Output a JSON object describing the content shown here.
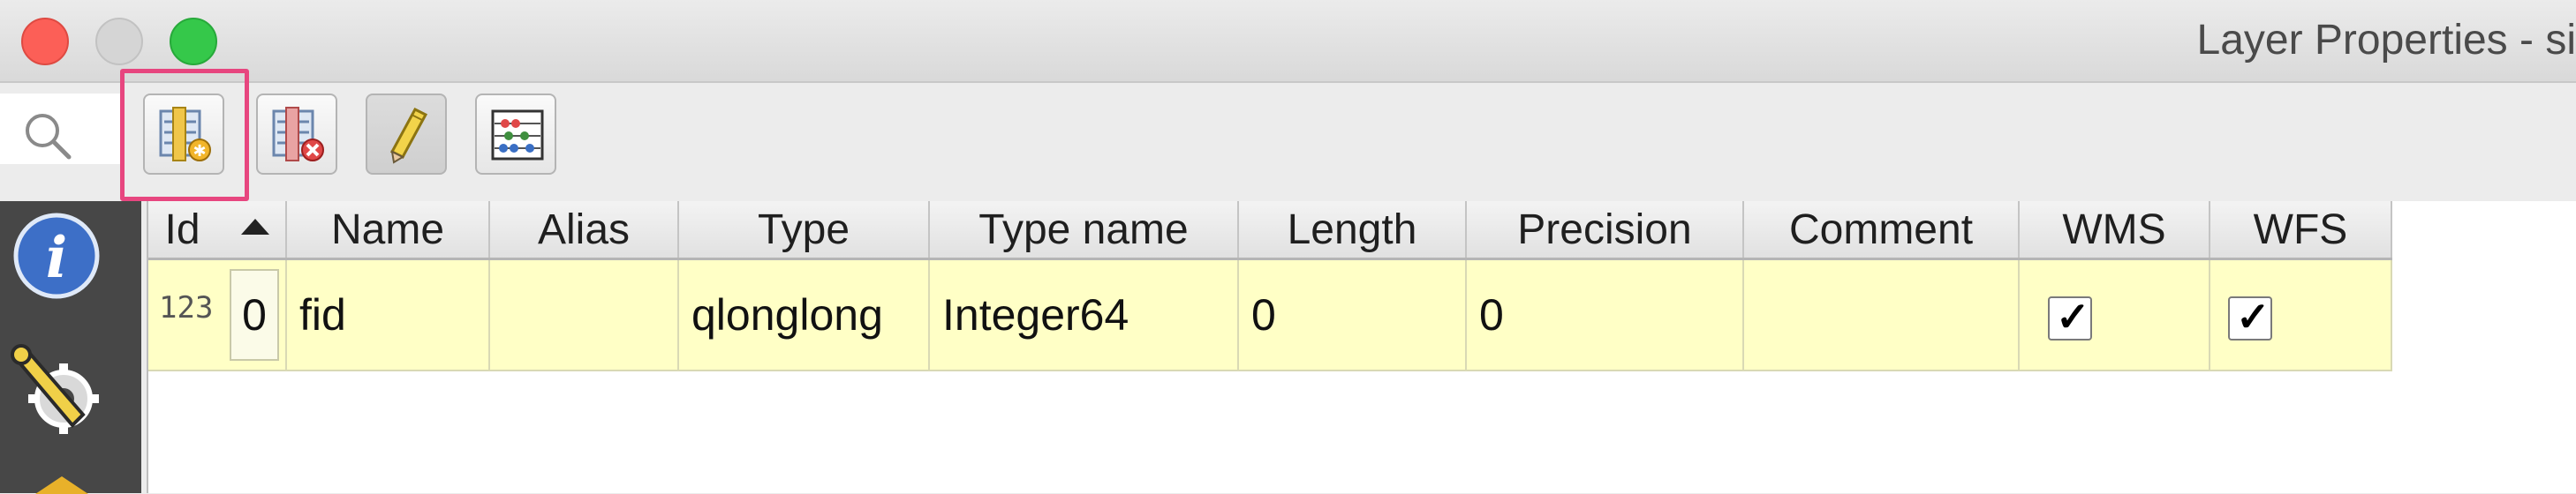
{
  "window": {
    "title": "Layer Properties - si"
  },
  "toolbar": {
    "buttons": [
      {
        "name": "new-field-button",
        "icon": "new-field-icon",
        "tooltip": ""
      },
      {
        "name": "delete-field-button",
        "icon": "delete-field-icon",
        "tooltip": ""
      },
      {
        "name": "toggle-editing-button",
        "icon": "pencil-icon",
        "tooltip": ""
      },
      {
        "name": "field-calculator-button",
        "icon": "abacus-icon",
        "tooltip": ""
      }
    ],
    "highlight_color": "#e7467f"
  },
  "sidebar": {
    "icons": [
      "information-icon",
      "source-settings-icon",
      "symbology-icon"
    ]
  },
  "table": {
    "headers": {
      "id": "Id",
      "name": "Name",
      "alias": "Alias",
      "type": "Type",
      "type_name": "Type name",
      "length": "Length",
      "precision": "Precision",
      "comment": "Comment",
      "wms": "WMS",
      "wfs": "WFS"
    },
    "rows": [
      {
        "type_badge": "123",
        "id": "0",
        "name": "fid",
        "alias": "",
        "type": "qlonglong",
        "type_name": "Integer64",
        "length": "0",
        "precision": "0",
        "comment": "",
        "wms": "✓",
        "wfs": "✓"
      }
    ],
    "row_color": "#ffffc6"
  }
}
